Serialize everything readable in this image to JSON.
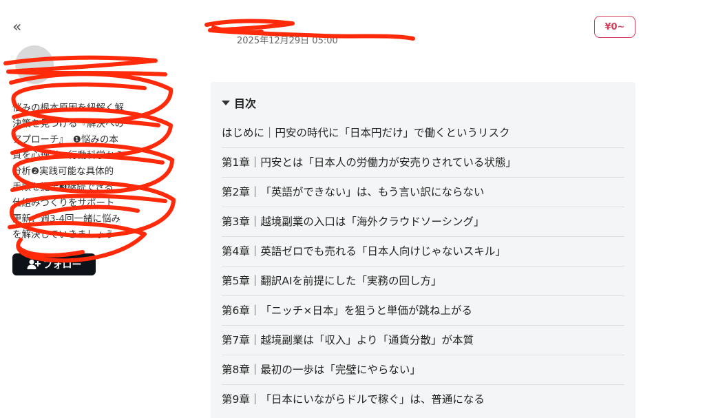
{
  "sidebar": {
    "collapse_label": "«",
    "author_name": "",
    "bio_lines": [
      "悩みの根本原因を紐解く解",
      "決策を見つける『解決への",
      "アプローチ』　❶悩みの本",
      "質を心理学・行動科学から",
      "分析❷実践可能な具体的",
      "手順を提示❸継続できる",
      "仕組みづくりをサポート",
      "更新：週3-4回一緒に悩み",
      "を解決していきましょう"
    ],
    "follow_label": "フォロー"
  },
  "header": {
    "date": "2025年12月29日 05:00",
    "price_label": "¥0~"
  },
  "toc": {
    "title": "目次",
    "items": [
      "はじめに｜円安の時代に「日本円だけ」で働くというリスク",
      "第1章｜円安とは「日本人の労働力が安売りされている状態」",
      "第2章｜「英語ができない」は、もう言い訳にならない",
      "第3章｜越境副業の入口は「海外クラウドソーシング」",
      "第4章｜英語ゼロでも売れる「日本人向けじゃないスキル」",
      "第5章｜翻訳AIを前提にした「実務の回し方」",
      "第6章｜「ニッチ×日本」を狙うと単価が跳ね上がる",
      "第7章｜越境副業は「収入」より「通貨分散」が本質",
      "第8章｜最初の一歩は「完璧にやらない」",
      "第9章｜「日本にいながらドルで稼ぐ」は、普通になる"
    ]
  },
  "colors": {
    "accent": "#d33c5b",
    "follow_bg": "#0c1217",
    "toc_bg": "#f4f5f6",
    "redaction": "#ff2a0a"
  }
}
